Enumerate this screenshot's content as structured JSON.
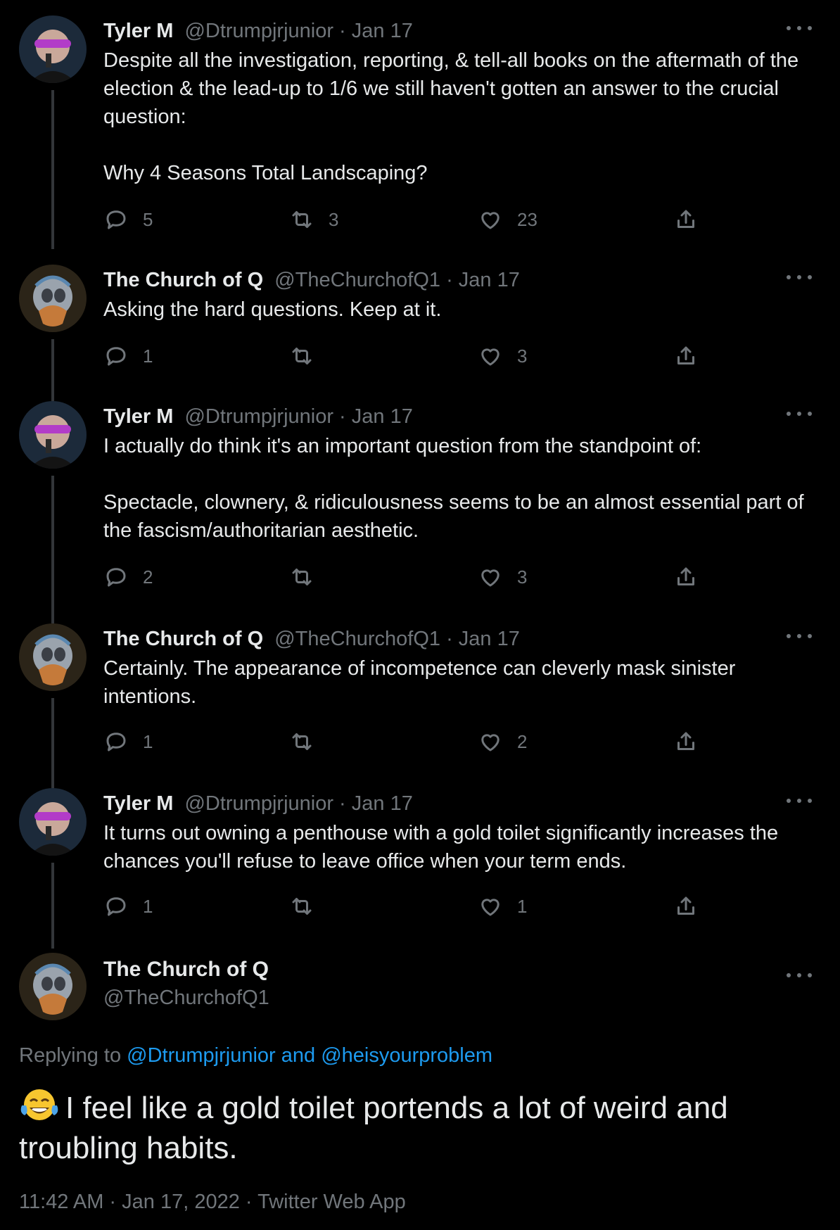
{
  "colors": {
    "background": "#000000",
    "text": "#e7e9ea",
    "muted": "#71767b",
    "link": "#1d9bf0",
    "thread_line": "#333639"
  },
  "tweets": [
    {
      "name": "Tyler M",
      "handle": "@Dtrumpjrjunior",
      "sep": " · ",
      "date": "Jan 17",
      "text": "Despite all the investigation, reporting, & tell-all books on the aftermath of the election & the lead-up to 1/6 we still haven't gotten an answer to the crucial question:\n\nWhy 4 Seasons Total Landscaping?",
      "replies": "5",
      "retweets": "3",
      "likes": "23",
      "avatar": "purple-mask-avatar"
    },
    {
      "name": "The Church of Q",
      "handle": "@TheChurchofQ1",
      "sep": " · ",
      "date": "Jan 17",
      "text": "Asking the hard questions. Keep at it.",
      "replies": "1",
      "retweets": "",
      "likes": "3",
      "avatar": "chrome-skull-avatar"
    },
    {
      "name": "Tyler M",
      "handle": "@Dtrumpjrjunior",
      "sep": " · ",
      "date": "Jan 17",
      "text": "I actually do think it's an important question from the standpoint of:\n\nSpectacle, clownery, & ridiculousness seems to be an almost essential part of the fascism/authoritarian aesthetic.",
      "replies": "2",
      "retweets": "",
      "likes": "3",
      "avatar": "purple-mask-avatar"
    },
    {
      "name": "The Church of Q",
      "handle": "@TheChurchofQ1",
      "sep": " · ",
      "date": "Jan 17",
      "text": "Certainly. The appearance of incompetence can cleverly mask sinister intentions.",
      "replies": "1",
      "retweets": "",
      "likes": "2",
      "avatar": "chrome-skull-avatar"
    },
    {
      "name": "Tyler M",
      "handle": "@Dtrumpjrjunior",
      "sep": " · ",
      "date": "Jan 17",
      "text": "It turns out owning a penthouse with a gold toilet significantly increases the chances you'll refuse to leave office when your term ends.",
      "replies": "1",
      "retweets": "",
      "likes": "1",
      "avatar": "purple-mask-avatar"
    }
  ],
  "focus": {
    "name": "The Church of Q",
    "handle": "@TheChurchofQ1",
    "replying_prefix": "Replying to ",
    "replying_user1": "@Dtrumpjrjunior",
    "replying_and": " and ",
    "replying_user2": "@heisyourproblem",
    "emoji": "tears-of-joy-emoji",
    "text": "I feel like a gold toilet portends a lot of weird and troubling habits.",
    "timestamp": "11:42 AM · Jan 17, 2022 · Twitter Web App"
  }
}
